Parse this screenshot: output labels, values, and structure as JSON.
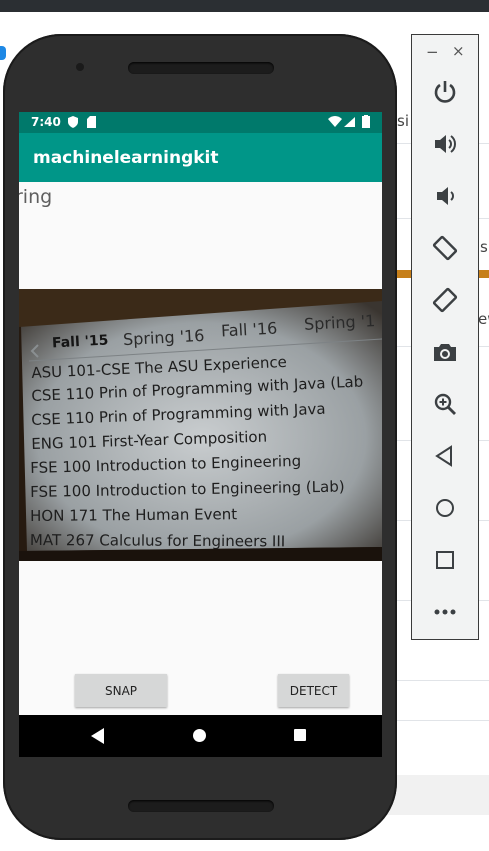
{
  "status_bar": {
    "time": "7:40"
  },
  "app": {
    "title": "machinelearningkit",
    "result_text": "ring"
  },
  "buttons": {
    "snap": "SNAP",
    "detect": "DETECT"
  },
  "photo": {
    "tabs": [
      "Fall '15",
      "Spring '16",
      "Fall '16",
      "Spring '1"
    ],
    "courses": [
      "ASU 101-CSE The ASU Experience",
      "CSE 110 Prin of Programming with Java (Lab",
      "CSE 110 Prin of Programming with Java",
      "ENG 101 First-Year Composition",
      "FSE 100 Introduction to Engineering",
      "FSE 100 Introduction to Engineering (Lab)",
      "HON 171 The Human Event",
      "MAT 267 Calculus for Engineers III"
    ]
  },
  "emulator": {
    "minimize": "−",
    "close": "×",
    "icons": [
      "power-icon",
      "volume-up-icon",
      "volume-down-icon",
      "rotate-left-icon",
      "rotate-right-icon",
      "camera-icon",
      "zoom-icon",
      "back-icon",
      "home-icon",
      "overview-icon",
      "more-icon"
    ]
  },
  "host": {
    "partial_text_1": "si",
    "partial_text_2": "s",
    "partial_text_3": "ew"
  },
  "colors": {
    "status_bar": "#00796b",
    "app_bar": "#009688"
  }
}
